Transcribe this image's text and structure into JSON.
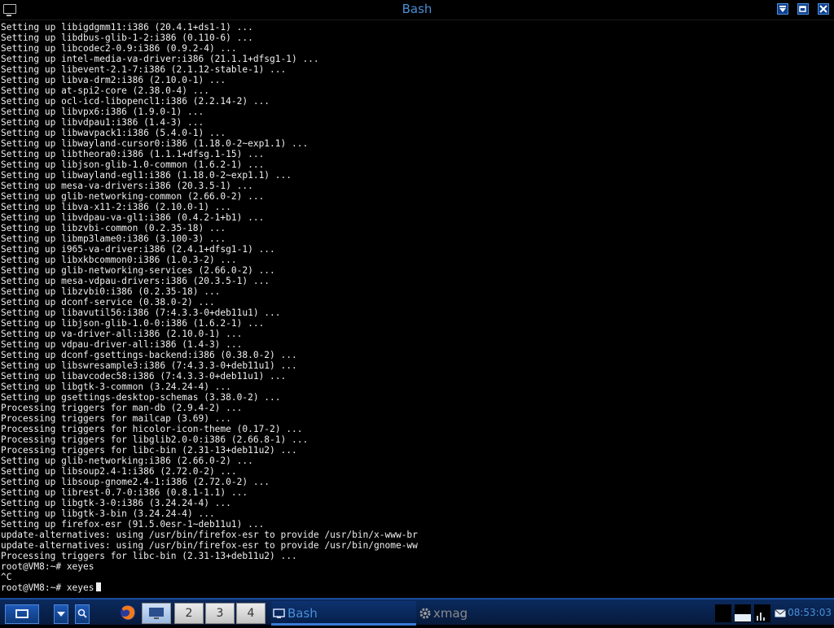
{
  "window": {
    "title": "Bash"
  },
  "terminal": {
    "lines": [
      "Setting up libigdgmm11:i386 (20.4.1+ds1-1) ...",
      "Setting up libdbus-glib-1-2:i386 (0.110-6) ...",
      "Setting up libcodec2-0.9:i386 (0.9.2-4) ...",
      "Setting up intel-media-va-driver:i386 (21.1.1+dfsg1-1) ...",
      "Setting up libevent-2.1-7:i386 (2.1.12-stable-1) ...",
      "Setting up libva-drm2:i386 (2.10.0-1) ...",
      "Setting up at-spi2-core (2.38.0-4) ...",
      "Setting up ocl-icd-libopencl1:i386 (2.2.14-2) ...",
      "Setting up libvpx6:i386 (1.9.0-1) ...",
      "Setting up libvdpau1:i386 (1.4-3) ...",
      "Setting up libwavpack1:i386 (5.4.0-1) ...",
      "Setting up libwayland-cursor0:i386 (1.18.0-2~exp1.1) ...",
      "Setting up libtheora0:i386 (1.1.1+dfsg.1-15) ...",
      "Setting up libjson-glib-1.0-common (1.6.2-1) ...",
      "Setting up libwayland-egl1:i386 (1.18.0-2~exp1.1) ...",
      "Setting up mesa-va-drivers:i386 (20.3.5-1) ...",
      "Setting up glib-networking-common (2.66.0-2) ...",
      "Setting up libva-x11-2:i386 (2.10.0-1) ...",
      "Setting up libvdpau-va-gl1:i386 (0.4.2-1+b1) ...",
      "Setting up libzvbi-common (0.2.35-18) ...",
      "Setting up libmp3lame0:i386 (3.100-3) ...",
      "Setting up i965-va-driver:i386 (2.4.1+dfsg1-1) ...",
      "Setting up libxkbcommon0:i386 (1.0.3-2) ...",
      "Setting up glib-networking-services (2.66.0-2) ...",
      "Setting up mesa-vdpau-drivers:i386 (20.3.5-1) ...",
      "Setting up libzvbi0:i386 (0.2.35-18) ...",
      "Setting up dconf-service (0.38.0-2) ...",
      "Setting up libavutil56:i386 (7:4.3.3-0+deb11u1) ...",
      "Setting up libjson-glib-1.0-0:i386 (1.6.2-1) ...",
      "Setting up va-driver-all:i386 (2.10.0-1) ...",
      "Setting up vdpau-driver-all:i386 (1.4-3) ...",
      "Setting up dconf-gsettings-backend:i386 (0.38.0-2) ...",
      "Setting up libswresample3:i386 (7:4.3.3-0+deb11u1) ...",
      "Setting up libavcodec58:i386 (7:4.3.3-0+deb11u1) ...",
      "Setting up libgtk-3-common (3.24.24-4) ...",
      "Setting up gsettings-desktop-schemas (3.38.0-2) ...",
      "Processing triggers for man-db (2.9.4-2) ...",
      "Processing triggers for mailcap (3.69) ...",
      "Processing triggers for hicolor-icon-theme (0.17-2) ...",
      "Processing triggers for libglib2.0-0:i386 (2.66.8-1) ...",
      "Processing triggers for libc-bin (2.31-13+deb11u2) ...",
      "Setting up glib-networking:i386 (2.66.0-2) ...",
      "Setting up libsoup2.4-1:i386 (2.72.0-2) ...",
      "Setting up libsoup-gnome2.4-1:i386 (2.72.0-2) ...",
      "Setting up librest-0.7-0:i386 (0.8.1-1.1) ...",
      "Setting up libgtk-3-0:i386 (3.24.24-4) ...",
      "Setting up libgtk-3-bin (3.24.24-4) ...",
      "Setting up firefox-esr (91.5.0esr-1~deb11u1) ...",
      "update-alternatives: using /usr/bin/firefox-esr to provide /usr/bin/x-www-br",
      "update-alternatives: using /usr/bin/firefox-esr to provide /usr/bin/gnome-ww",
      "Processing triggers for libc-bin (2.31-13+deb11u2) ...",
      "root@VM8:~# xeyes",
      "^C"
    ],
    "prompt": "root@VM8:~# xeyes"
  },
  "panel": {
    "workspaces": [
      "2",
      "3",
      "4"
    ],
    "tasks": [
      {
        "label": "Bash",
        "icon": "terminal-icon",
        "active": true
      },
      {
        "label": "xmag",
        "icon": "gear-icon",
        "active": false
      }
    ],
    "clock": "08:53:03"
  },
  "icons": {
    "titlebar": [
      "window-menu-icon",
      "shade-icon",
      "maximize-icon",
      "close-icon"
    ],
    "panel": [
      "desktop-icon",
      "menu-arrow-icon",
      "search-icon",
      "firefox-icon",
      "show-desktop-icon",
      "mail-icon",
      "network-icon"
    ]
  },
  "colors": {
    "accent": "#4a8fd8",
    "panel": "#0a2a5e",
    "terminal_bg": "#000000",
    "terminal_fg": "#f0f0f0"
  }
}
